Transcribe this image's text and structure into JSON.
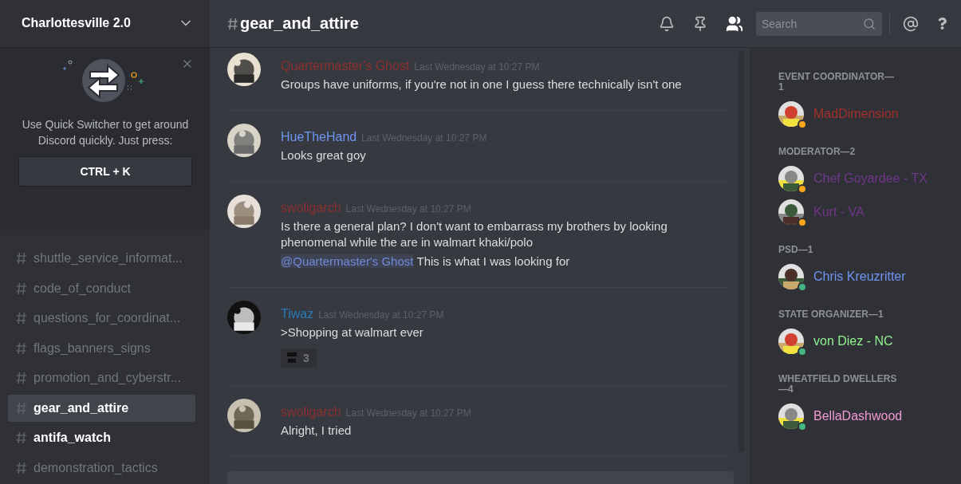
{
  "server": {
    "name": "Charlottesville 2.0"
  },
  "tip": {
    "text": "Use Quick Switcher to get around Discord quickly. Just press:",
    "shortcut": "CTRL + K"
  },
  "channels": [
    {
      "name": "shuttle_service_informat...",
      "selected": false,
      "unread": false
    },
    {
      "name": "code_of_conduct",
      "selected": false,
      "unread": false
    },
    {
      "name": "questions_for_coordinat...",
      "selected": false,
      "unread": false
    },
    {
      "name": "flags_banners_signs",
      "selected": false,
      "unread": false
    },
    {
      "name": "promotion_and_cyberstr...",
      "selected": false,
      "unread": false
    },
    {
      "name": "gear_and_attire",
      "selected": true,
      "unread": false
    },
    {
      "name": "antifa_watch",
      "selected": false,
      "unread": true
    },
    {
      "name": "demonstration_tactics",
      "selected": false,
      "unread": false
    }
  ],
  "header": {
    "channel": "gear_and_attire",
    "search": {
      "placeholder": "Search"
    }
  },
  "messages": [
    {
      "author": "Quartermaster's Ghost",
      "color": "#8c2f2f",
      "time": "Last Wednesday at 10:27 PM",
      "lines": [
        {
          "text": "Groups have uniforms, if you're not in one I guess there technically isn't one"
        }
      ]
    },
    {
      "author": "HueTheHand",
      "color": "#6f96f2",
      "time": "Last Wednesday at 10:27 PM",
      "lines": [
        {
          "text": "Looks great goy"
        }
      ]
    },
    {
      "author": "swoligarch",
      "color": "#8c2f2f",
      "time": "Last Wednesday at 10:27 PM",
      "lines": [
        {
          "text": "Is there a general plan? I don't want to embarrass my brothers by looking phenomenal while the are in walmart khaki/polo"
        },
        {
          "mention": "@Quartermaster's Ghost",
          "text": "This is what I was looking for"
        }
      ]
    },
    {
      "author": "Tiwaz",
      "color": "#2a79b8",
      "time": "Last Wednesday at 10:27 PM",
      "lines": [
        {
          "text": ">Shopping at walmart ever"
        }
      ],
      "reactions": [
        {
          "count": "3"
        }
      ]
    },
    {
      "author": "swoligarch",
      "color": "#8c2f2f",
      "time": "Last Wednesday at 10:27 PM",
      "lines": [
        {
          "text": "Alright, I tried"
        }
      ]
    }
  ],
  "member_groups": [
    {
      "title": "EVENT COORDINATOR—1",
      "members": [
        {
          "name": "MadDimension",
          "color": "#a3302a",
          "status": {
            "color": "#faa61a"
          }
        }
      ]
    },
    {
      "title": "MODERATOR—2",
      "members": [
        {
          "name": "Chef Goyardee - TX",
          "color": "#71368a",
          "status": {
            "color": "#faa61a"
          }
        },
        {
          "name": "Kurt - VA",
          "color": "#71368a",
          "status": {
            "color": "#faa61a"
          }
        }
      ]
    },
    {
      "title": "PSD—1",
      "members": [
        {
          "name": "Chris Kreuzritter",
          "color": "#6f96f2",
          "status": {
            "color": "#43b581"
          }
        }
      ]
    },
    {
      "title": "STATE ORGANIZER—1",
      "members": [
        {
          "name": "von Diez - NC",
          "color": "#8ff28f",
          "status": {
            "color": "#43b581"
          }
        }
      ]
    },
    {
      "title": "WHEATFIELD DWELLERS—4",
      "members": [
        {
          "name": "BellaDashwood",
          "color": "#f29ad2",
          "status": {
            "color": "#43b581"
          }
        }
      ]
    }
  ]
}
